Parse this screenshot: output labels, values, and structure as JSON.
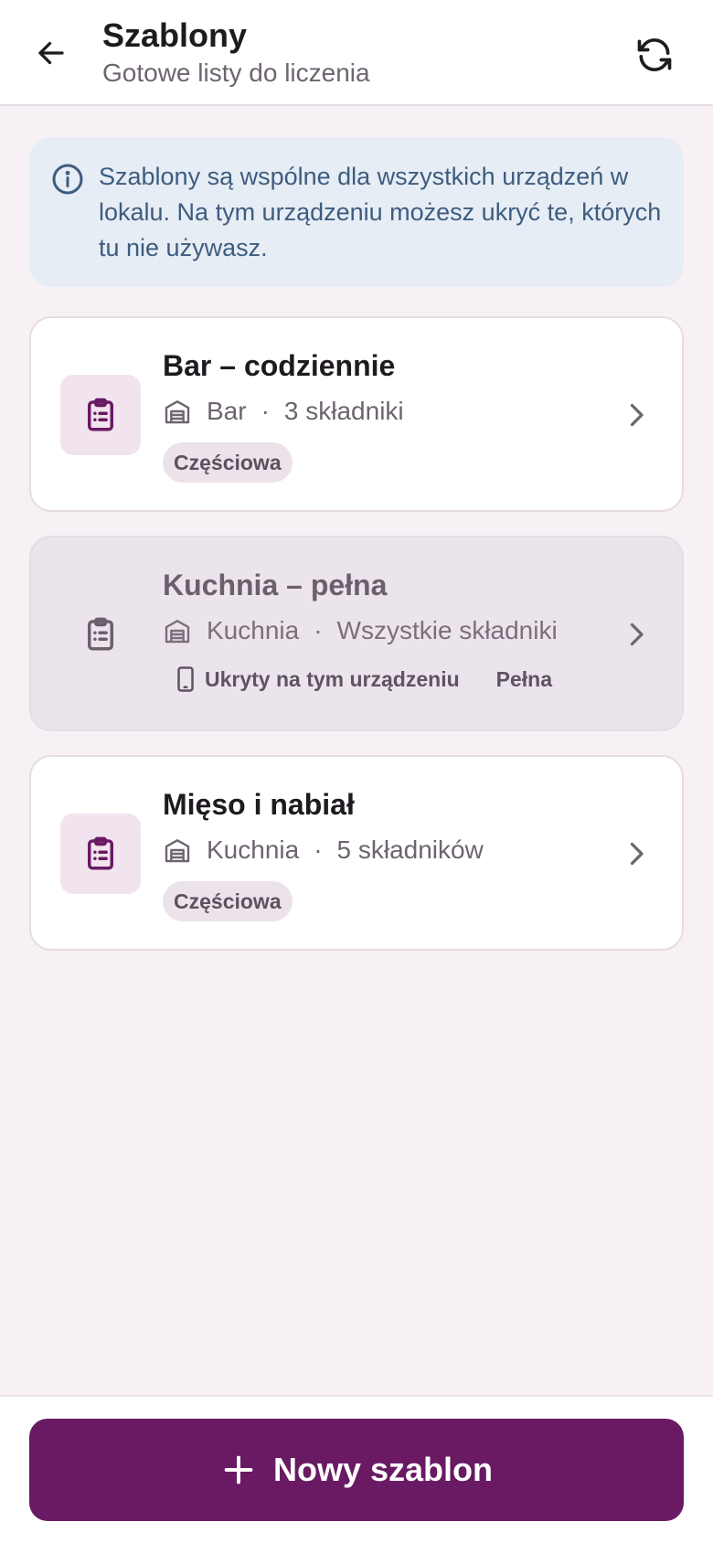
{
  "header": {
    "title": "Szablony",
    "subtitle": "Gotowe listy do liczenia",
    "back_icon": "arrow-left-icon",
    "refresh_icon": "refresh-icon"
  },
  "info": {
    "icon": "info-icon",
    "text": "Szablony są wspólne dla wszystkich urządzeń w lokalu. Na tym urządzeniu możesz ukryć te, których tu nie używasz."
  },
  "templates": [
    {
      "title": "Bar – codziennie",
      "location": "Bar",
      "count": "3 składniki",
      "badge": "Częściowa",
      "hidden": false
    },
    {
      "title": "Kuchnia – pełna",
      "location": "Kuchnia",
      "count": "Wszystkie składniki",
      "hidden_label": "Ukryty na tym urządzeniu",
      "badge": "Pełna",
      "hidden": true
    },
    {
      "title": "Mięso i nabiał",
      "location": "Kuchnia",
      "count": "5 składników",
      "badge": "Częściowa",
      "hidden": false
    }
  ],
  "separator": "·",
  "footer": {
    "new_button_label": "Nowy szablon",
    "plus_icon": "plus-icon"
  },
  "colors": {
    "accent": "#691a63",
    "background": "#f7f1f6",
    "info_bg": "#e6edf4",
    "info_text": "#3e5c80"
  }
}
